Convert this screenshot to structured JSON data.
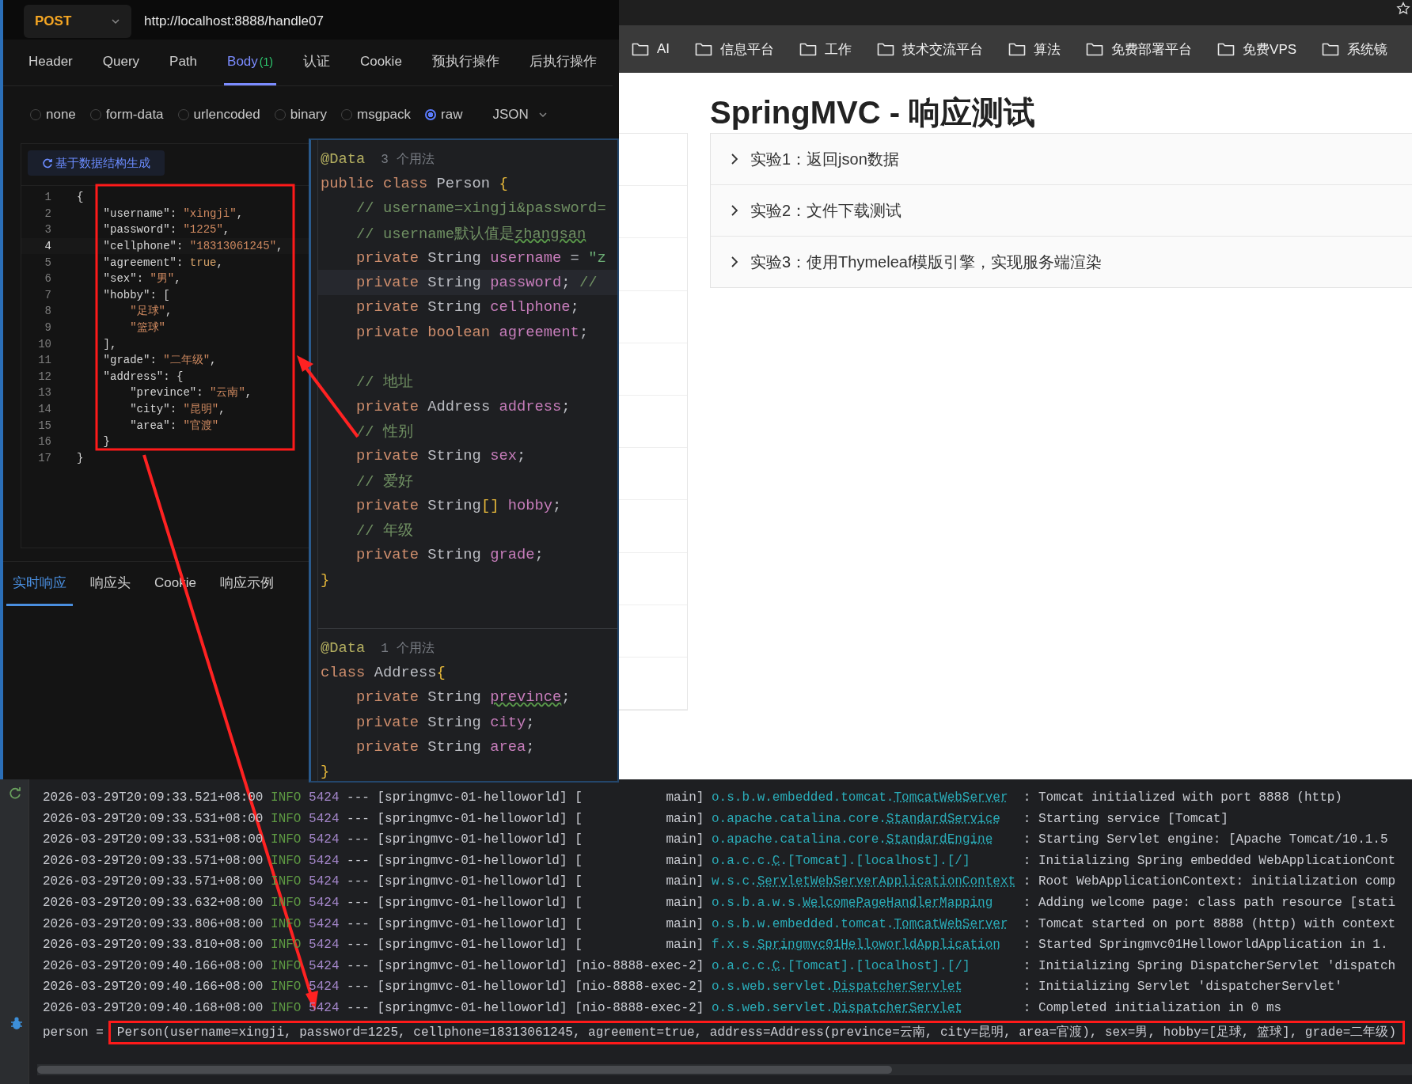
{
  "api": {
    "method": "POST",
    "url": "http://localhost:8888/handle07",
    "tabs": [
      {
        "label": "Header",
        "selected": false
      },
      {
        "label": "Query",
        "selected": false
      },
      {
        "label": "Path",
        "selected": false
      },
      {
        "label": "Body",
        "badge": "(1)",
        "selected": true
      },
      {
        "label": "认证",
        "selected": false
      },
      {
        "label": "Cookie",
        "selected": false
      },
      {
        "label": "预执行操作",
        "selected": false
      },
      {
        "label": "后执行操作",
        "selected": false
      }
    ],
    "body_types": [
      {
        "label": "none",
        "selected": false
      },
      {
        "label": "form-data",
        "selected": false
      },
      {
        "label": "urlencoded",
        "selected": false
      },
      {
        "label": "binary",
        "selected": false
      },
      {
        "label": "msgpack",
        "selected": false
      },
      {
        "label": "raw",
        "selected": true
      }
    ],
    "format": "JSON",
    "generate_button": "基于数据结构生成",
    "json_lines": [
      {
        "number": "1",
        "current": false,
        "tokens": [
          {
            "text": "{",
            "kind": "punct"
          }
        ]
      },
      {
        "number": "2",
        "current": false,
        "tokens": [
          {
            "text": "    \"username\"",
            "kind": "key"
          },
          {
            "text": ": ",
            "kind": "punct"
          },
          {
            "text": "\"xingji\"",
            "kind": "str"
          },
          {
            "text": ",",
            "kind": "punct"
          }
        ]
      },
      {
        "number": "3",
        "current": false,
        "tokens": [
          {
            "text": "    \"password\"",
            "kind": "key"
          },
          {
            "text": ": ",
            "kind": "punct"
          },
          {
            "text": "\"1225\"",
            "kind": "str"
          },
          {
            "text": ",",
            "kind": "punct"
          }
        ]
      },
      {
        "number": "4",
        "current": true,
        "tokens": [
          {
            "text": "    \"cellphone\"",
            "kind": "key"
          },
          {
            "text": ": ",
            "kind": "punct"
          },
          {
            "text": "\"18313061245\"",
            "kind": "str"
          },
          {
            "text": ",",
            "kind": "punct"
          }
        ]
      },
      {
        "number": "5",
        "current": false,
        "tokens": [
          {
            "text": "    \"agreement\"",
            "kind": "key"
          },
          {
            "text": ": ",
            "kind": "punct"
          },
          {
            "text": "true",
            "kind": "lit"
          },
          {
            "text": ",",
            "kind": "punct"
          }
        ]
      },
      {
        "number": "6",
        "current": false,
        "tokens": [
          {
            "text": "    \"sex\"",
            "kind": "key"
          },
          {
            "text": ": ",
            "kind": "punct"
          },
          {
            "text": "\"男\"",
            "kind": "str"
          },
          {
            "text": ",",
            "kind": "punct"
          }
        ]
      },
      {
        "number": "7",
        "current": false,
        "tokens": [
          {
            "text": "    \"hobby\"",
            "kind": "key"
          },
          {
            "text": ": [",
            "kind": "punct"
          }
        ]
      },
      {
        "number": "8",
        "current": false,
        "tokens": [
          {
            "text": "        \"足球\"",
            "kind": "str"
          },
          {
            "text": ",",
            "kind": "punct"
          }
        ]
      },
      {
        "number": "9",
        "current": false,
        "tokens": [
          {
            "text": "        \"篮球\"",
            "kind": "str"
          }
        ]
      },
      {
        "number": "10",
        "current": false,
        "tokens": [
          {
            "text": "    ],",
            "kind": "punct"
          }
        ]
      },
      {
        "number": "11",
        "current": false,
        "tokens": [
          {
            "text": "    \"grade\"",
            "kind": "key"
          },
          {
            "text": ": ",
            "kind": "punct"
          },
          {
            "text": "\"二年级\"",
            "kind": "str"
          },
          {
            "text": ",",
            "kind": "punct"
          }
        ]
      },
      {
        "number": "12",
        "current": false,
        "tokens": [
          {
            "text": "    \"address\"",
            "kind": "key"
          },
          {
            "text": ": {",
            "kind": "punct"
          }
        ]
      },
      {
        "number": "13",
        "current": false,
        "tokens": [
          {
            "text": "        \"prevince\"",
            "kind": "key"
          },
          {
            "text": ": ",
            "kind": "punct"
          },
          {
            "text": "\"云南\"",
            "kind": "str"
          },
          {
            "text": ",",
            "kind": "punct"
          }
        ]
      },
      {
        "number": "14",
        "current": false,
        "tokens": [
          {
            "text": "        \"city\"",
            "kind": "key"
          },
          {
            "text": ": ",
            "kind": "punct"
          },
          {
            "text": "\"昆明\"",
            "kind": "str"
          },
          {
            "text": ",",
            "kind": "punct"
          }
        ]
      },
      {
        "number": "15",
        "current": false,
        "tokens": [
          {
            "text": "        \"area\"",
            "kind": "key"
          },
          {
            "text": ": ",
            "kind": "punct"
          },
          {
            "text": "\"官渡\"",
            "kind": "str"
          }
        ]
      },
      {
        "number": "16",
        "current": false,
        "tokens": [
          {
            "text": "    }",
            "kind": "punct"
          }
        ]
      },
      {
        "number": "17",
        "current": false,
        "tokens": [
          {
            "text": "}",
            "kind": "punct"
          }
        ]
      }
    ],
    "response_tabs": [
      {
        "label": "实时响应",
        "selected": true
      },
      {
        "label": "响应头",
        "selected": false
      },
      {
        "label": "Cookie",
        "selected": false
      },
      {
        "label": "响应示例",
        "selected": false
      }
    ]
  },
  "code_editor": {
    "sections": [
      {
        "lines": [
          {
            "current": false,
            "tokens": [
              {
                "text": "@Data",
                "kind": "anno"
              },
              {
                "text": "3 个用法",
                "kind": "hint"
              }
            ]
          },
          {
            "current": false,
            "tokens": [
              {
                "text": "public class",
                "kind": "kw"
              },
              {
                "text": " Person ",
                "kind": "type"
              },
              {
                "text": "{",
                "kind": "brace"
              }
            ]
          },
          {
            "current": false,
            "tokens": [
              {
                "text": "    // username=xingji&password=",
                "kind": "comment"
              }
            ]
          },
          {
            "current": false,
            "tokens": [
              {
                "text": "    // username默认值是",
                "kind": "comment"
              },
              {
                "text": "zhangsan",
                "kind": "comment-typo"
              }
            ]
          },
          {
            "current": false,
            "tokens": [
              {
                "text": "    private",
                "kind": "kw"
              },
              {
                "text": " String ",
                "kind": "type"
              },
              {
                "text": "username",
                "kind": "field"
              },
              {
                "text": " = ",
                "kind": "plain"
              },
              {
                "text": "\"z",
                "kind": "str"
              }
            ]
          },
          {
            "current": true,
            "tokens": [
              {
                "text": "    private",
                "kind": "kw"
              },
              {
                "text": " String ",
                "kind": "type"
              },
              {
                "text": "password",
                "kind": "field"
              },
              {
                "text": "; ",
                "kind": "plain"
              },
              {
                "text": "//",
                "kind": "comment"
              }
            ]
          },
          {
            "current": false,
            "tokens": [
              {
                "text": "    private",
                "kind": "kw"
              },
              {
                "text": " String ",
                "kind": "type"
              },
              {
                "text": "cellphone",
                "kind": "field"
              },
              {
                "text": ";",
                "kind": "plain"
              }
            ]
          },
          {
            "current": false,
            "tokens": [
              {
                "text": "    private boolean",
                "kind": "kw"
              },
              {
                "text": " agreement",
                "kind": "field"
              },
              {
                "text": ";",
                "kind": "plain"
              }
            ]
          },
          {
            "current": false
          },
          {
            "current": false,
            "tokens": [
              {
                "text": "    // 地址",
                "kind": "comment"
              }
            ]
          },
          {
            "current": false,
            "tokens": [
              {
                "text": "    private",
                "kind": "kw"
              },
              {
                "text": " Address ",
                "kind": "type"
              },
              {
                "text": "address",
                "kind": "field"
              },
              {
                "text": ";",
                "kind": "plain"
              }
            ]
          },
          {
            "current": false,
            "tokens": [
              {
                "text": "    // 性别",
                "kind": "comment"
              }
            ]
          },
          {
            "current": false,
            "tokens": [
              {
                "text": "    private",
                "kind": "kw"
              },
              {
                "text": " String ",
                "kind": "type"
              },
              {
                "text": "sex",
                "kind": "field"
              },
              {
                "text": ";",
                "kind": "plain"
              }
            ]
          },
          {
            "current": false,
            "tokens": [
              {
                "text": "    // 爱好",
                "kind": "comment"
              }
            ]
          },
          {
            "current": false,
            "tokens": [
              {
                "text": "    private",
                "kind": "kw"
              },
              {
                "text": " String",
                "kind": "type"
              },
              {
                "text": "[]",
                "kind": "brace"
              },
              {
                "text": " hobby",
                "kind": "field"
              },
              {
                "text": ";",
                "kind": "plain"
              }
            ]
          },
          {
            "current": false,
            "tokens": [
              {
                "text": "    // 年级",
                "kind": "comment"
              }
            ]
          },
          {
            "current": false,
            "tokens": [
              {
                "text": "    private",
                "kind": "kw"
              },
              {
                "text": " String ",
                "kind": "type"
              },
              {
                "text": "grade",
                "kind": "field"
              },
              {
                "text": ";",
                "kind": "plain"
              }
            ]
          },
          {
            "current": false,
            "tokens": [
              {
                "text": "}",
                "kind": "brace"
              }
            ]
          }
        ]
      },
      {
        "lines": [
          {
            "current": false,
            "tokens": [
              {
                "text": "@Data",
                "kind": "anno"
              },
              {
                "text": "1 个用法",
                "kind": "hint"
              }
            ]
          },
          {
            "current": false,
            "tokens": [
              {
                "text": "class",
                "kind": "kw"
              },
              {
                "text": " Address",
                "kind": "type"
              },
              {
                "text": "{",
                "kind": "brace"
              }
            ]
          },
          {
            "current": false,
            "tokens": [
              {
                "text": "    private",
                "kind": "kw"
              },
              {
                "text": " String ",
                "kind": "type"
              },
              {
                "text": "prevince",
                "kind": "field-typo"
              },
              {
                "text": ";",
                "kind": "plain"
              }
            ]
          },
          {
            "current": false,
            "tokens": [
              {
                "text": "    private",
                "kind": "kw"
              },
              {
                "text": " String ",
                "kind": "type"
              },
              {
                "text": "city",
                "kind": "field"
              },
              {
                "text": ";",
                "kind": "plain"
              }
            ]
          },
          {
            "current": false,
            "tokens": [
              {
                "text": "    private",
                "kind": "kw"
              },
              {
                "text": " String ",
                "kind": "type"
              },
              {
                "text": "area",
                "kind": "field"
              },
              {
                "text": ";",
                "kind": "plain"
              }
            ]
          },
          {
            "current": false,
            "tokens": [
              {
                "text": "}",
                "kind": "brace"
              }
            ]
          }
        ]
      }
    ]
  },
  "browser": {
    "bookmarks": [
      "AI",
      "信息平台",
      "工作",
      "技术交流平台",
      "算法",
      "免费部署平台",
      "免费VPS",
      "系统镜"
    ],
    "page_title": "SpringMVC - 响应测试",
    "experiments": [
      {
        "label": "实验1：返回json数据",
        "expanded": false
      },
      {
        "label": "实验2：文件下载测试",
        "expanded": false
      },
      {
        "label": "实验3：使用Thymeleaf模版引擎，实现服务端渲染",
        "expanded": false
      }
    ]
  },
  "console": {
    "log_lines": [
      {
        "timestamp": "2026-03-29T20:09:33.521+08:00",
        "level": "INFO",
        "pid": "5424",
        "separator": "---",
        "app": "[springmvc-01-helloworld]",
        "thread": "[           main]",
        "logger_package": "o.s.b.w.embedded.tomcat.",
        "logger_class": "TomcatWebServer",
        "message": ": Tomcat initialized with port 8888 (http)"
      },
      {
        "timestamp": "2026-03-29T20:09:33.531+08:00",
        "level": "INFO",
        "pid": "5424",
        "separator": "---",
        "app": "[springmvc-01-helloworld]",
        "thread": "[           main]",
        "logger_package": "o.apache.catalina.core.",
        "logger_class": "StandardService",
        "message": ": Starting service [Tomcat]"
      },
      {
        "timestamp": "2026-03-29T20:09:33.531+08:00",
        "level": "INFO",
        "pid": "5424",
        "separator": "---",
        "app": "[springmvc-01-helloworld]",
        "thread": "[           main]",
        "logger_package": "o.apache.catalina.core.",
        "logger_class": "StandardEngine",
        "message": ": Starting Servlet engine: [Apache Tomcat/10.1.5"
      },
      {
        "timestamp": "2026-03-29T20:09:33.571+08:00",
        "level": "INFO",
        "pid": "5424",
        "separator": "---",
        "app": "[springmvc-01-helloworld]",
        "thread": "[           main]",
        "logger_package": "o.a.c.c.",
        "logger_class": "C",
        "logger_suffix": ".[Tomcat].[localhost].[/]",
        "message": ": Initializing Spring embedded WebApplicationCont"
      },
      {
        "timestamp": "2026-03-29T20:09:33.571+08:00",
        "level": "INFO",
        "pid": "5424",
        "separator": "---",
        "app": "[springmvc-01-helloworld]",
        "thread": "[           main]",
        "logger_package": "w.s.c.",
        "logger_class": "ServletWebServerApplicationContext",
        "message": ": Root WebApplicationContext: initialization comp"
      },
      {
        "timestamp": "2026-03-29T20:09:33.632+08:00",
        "level": "INFO",
        "pid": "5424",
        "separator": "---",
        "app": "[springmvc-01-helloworld]",
        "thread": "[           main]",
        "logger_package": "o.s.b.a.w.s.",
        "logger_class": "WelcomePageHandlerMapping",
        "message": ": Adding welcome page: class path resource [stati"
      },
      {
        "timestamp": "2026-03-29T20:09:33.806+08:00",
        "level": "INFO",
        "pid": "5424",
        "separator": "---",
        "app": "[springmvc-01-helloworld]",
        "thread": "[           main]",
        "logger_package": "o.s.b.w.embedded.tomcat.",
        "logger_class": "TomcatWebServer",
        "message": ": Tomcat started on port 8888 (http) with context"
      },
      {
        "timestamp": "2026-03-29T20:09:33.810+08:00",
        "level": "INFO",
        "pid": "5424",
        "separator": "---",
        "app": "[springmvc-01-helloworld]",
        "thread": "[           main]",
        "logger_package": "f.x.s.",
        "logger_class": "Springmvc01HelloworldApplication",
        "message": ": Started Springmvc01HelloworldApplication in 1."
      },
      {
        "timestamp": "2026-03-29T20:09:40.166+08:00",
        "level": "INFO",
        "pid": "5424",
        "separator": "---",
        "app": "[springmvc-01-helloworld]",
        "thread": "[nio-8888-exec-2]",
        "logger_package": "o.a.c.c.",
        "logger_class": "C",
        "logger_suffix": ".[Tomcat].[localhost].[/]",
        "message": ": Initializing Spring DispatcherServlet 'dispatch"
      },
      {
        "timestamp": "2026-03-29T20:09:40.166+08:00",
        "level": "INFO",
        "pid": "5424",
        "separator": "---",
        "app": "[springmvc-01-helloworld]",
        "thread": "[nio-8888-exec-2]",
        "logger_package": "o.s.web.servlet.",
        "logger_class": "DispatcherServlet",
        "message": ": Initializing Servlet 'dispatcherServlet'"
      },
      {
        "timestamp": "2026-03-29T20:09:40.168+08:00",
        "level": "INFO",
        "pid": "5424",
        "separator": "---",
        "app": "[springmvc-01-helloworld]",
        "thread": "[nio-8888-exec-2]",
        "logger_package": "o.s.web.servlet.",
        "logger_class": "DispatcherServlet",
        "message": ": Completed initialization in 0 ms"
      }
    ],
    "print_line": {
      "label": "person =",
      "value": "Person(username=xingji, password=1225, cellphone=18313061245, agreement=true, address=Address(prevince=云南, city=昆明, area=官渡), sex=男, hobby=[足球, 篮球], grade=二年级)"
    }
  }
}
